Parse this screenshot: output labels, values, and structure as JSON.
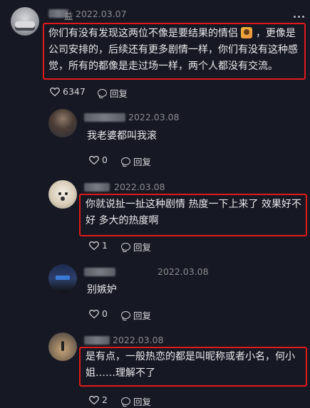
{
  "main": {
    "username_suffix": "益",
    "date": "2022.03.07",
    "text_part1": "你们有没有发现这两位不像是要结果的情侣",
    "text_part2": "，更像是公司安排的，后续还有更多剧情一样，你们有没有这种感觉，所有的都像是走过场一样，两个人都没有交流。",
    "likes": "6347",
    "reply_label": "回复",
    "emoji_icon": "couple-emoji"
  },
  "replies": [
    {
      "date": "2022.03.08",
      "text": "我老婆都叫我滚",
      "likes": "0",
      "reply_label": "回复"
    },
    {
      "date": "2022.03.08",
      "text": "你就说扯一扯这种剧情 热度一下上来了 效果好不好 多大的热度啊",
      "likes": "1",
      "reply_label": "回复"
    },
    {
      "date": "2022.03.08",
      "text": "别嫉妒",
      "likes": "0",
      "reply_label": "回复"
    },
    {
      "date": "2022.03.08",
      "text": "是有点，一般热恋的都是叫昵称或者小名，何小姐……理解不了",
      "likes": "2",
      "reply_label": "回复"
    }
  ],
  "icons": {
    "like": "heart-outline-icon",
    "reply": "comment-bubble-icon",
    "more": "more-dots-icon"
  },
  "colors": {
    "background": "#161823",
    "highlight_border": "#e01a1a",
    "meta_text": "#8a8b91"
  }
}
